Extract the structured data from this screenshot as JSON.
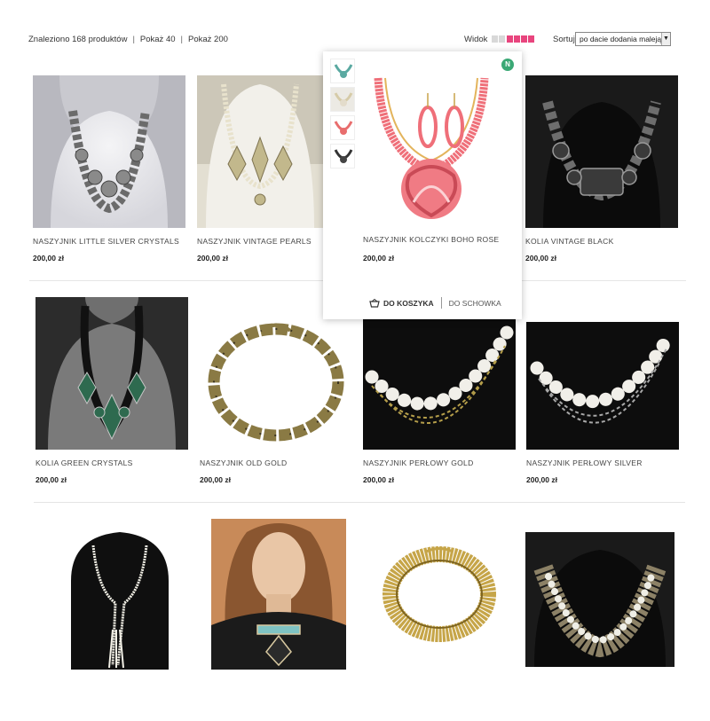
{
  "toolbar": {
    "found": "Znaleziono 168 produktów",
    "sep": "|",
    "show40": "Pokaż 40",
    "show200": "Pokaż 200",
    "view_label": "Widok",
    "sort_label": "Sortuj",
    "sort_value": "po dacie dodania malejąco"
  },
  "products": [
    {
      "name": "NASZYJNIK LITTLE SILVER CRYSTALS",
      "price": "200,00 zł"
    },
    {
      "name": "NASZYJNIK VINTAGE PEARLS",
      "price": "200,00 zł"
    },
    {
      "name": "KOLIA VINTAGE BLACK",
      "price": "200,00 zł"
    },
    {
      "name": "KOLIA GREEN CRYSTALS",
      "price": "200,00 zł"
    },
    {
      "name": "NASZYJNIK OLD GOLD",
      "price": "200,00 zł"
    },
    {
      "name": "NASZYJNIK PERŁOWY GOLD",
      "price": "200,00 zł"
    },
    {
      "name": "NASZYJNIK PERŁOWY SILVER",
      "price": "200,00 zł"
    }
  ],
  "popup": {
    "badge": "N",
    "name": "NASZYJNIK KOLCZYKI BOHO ROSE",
    "price": "200,00 zł",
    "cart": "DO KOSZYKA",
    "fav": "DO SCHOWKA"
  },
  "colors": {
    "accent": "#e8457e",
    "new_badge": "#3aa875"
  }
}
